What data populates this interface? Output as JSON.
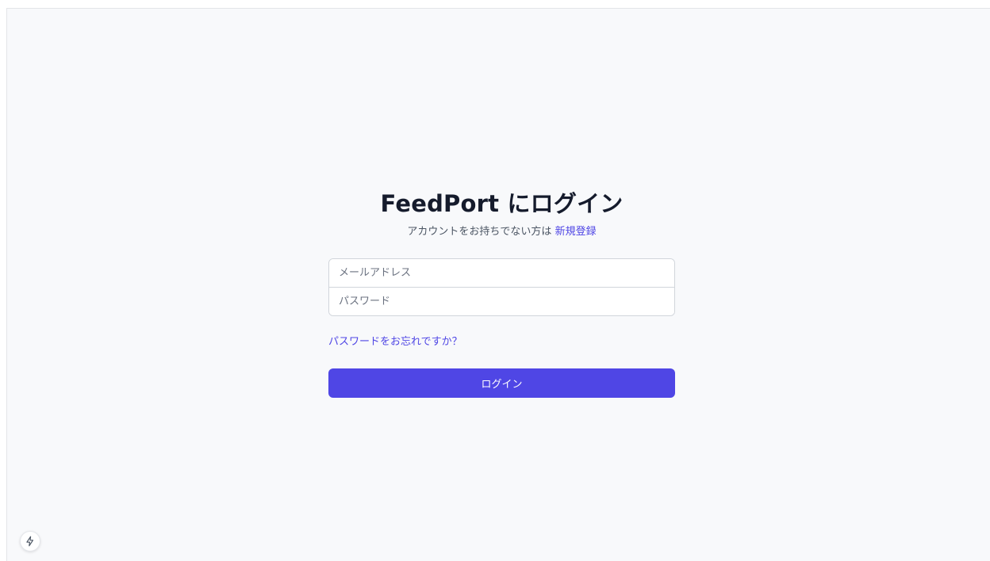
{
  "login": {
    "title": "FeedPort にログイン",
    "subtitle_text": "アカウントをお持ちでない方は ",
    "signup_link": "新規登録",
    "email_placeholder": "メールアドレス",
    "password_placeholder": "パスワード",
    "forgot_link": "パスワードをお忘れですか？",
    "submit_label": "ログイン"
  },
  "icons": {
    "dev_badge": "lightning-bolt-icon"
  },
  "colors": {
    "accent": "#4f46e5",
    "background": "#f8f9fb",
    "title": "#151b2c"
  }
}
